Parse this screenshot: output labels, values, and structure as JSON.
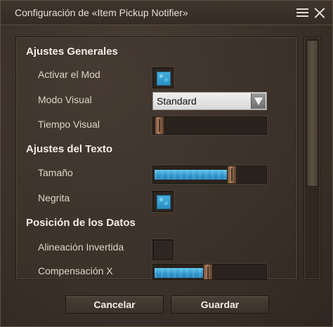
{
  "window": {
    "title": "Configuración de «Item Pickup Notifier»"
  },
  "sections": {
    "general": "Ajustes Generales",
    "text": "Ajustes del Texto",
    "position": "Posición de los Datos"
  },
  "settings": {
    "enable_mod": {
      "label": "Activar el Mod",
      "checked": true
    },
    "visual_mode": {
      "label": "Modo Visual",
      "value": "Standard"
    },
    "visual_time": {
      "label": "Tiempo Visual",
      "fraction": 0.0
    },
    "size": {
      "label": "Tamaño",
      "fraction": 0.72
    },
    "bold": {
      "label": "Negrita",
      "checked": true
    },
    "inverted_alignment": {
      "label": "Alineación Invertida",
      "checked": false
    },
    "offset_x": {
      "label": "Compensación X",
      "fraction": 0.48
    }
  },
  "buttons": {
    "cancel": "Cancelar",
    "save": "Guardar"
  },
  "colors": {
    "accent": "#3fa9d8",
    "background": "#3a3029",
    "text": "#ddd5c9"
  }
}
